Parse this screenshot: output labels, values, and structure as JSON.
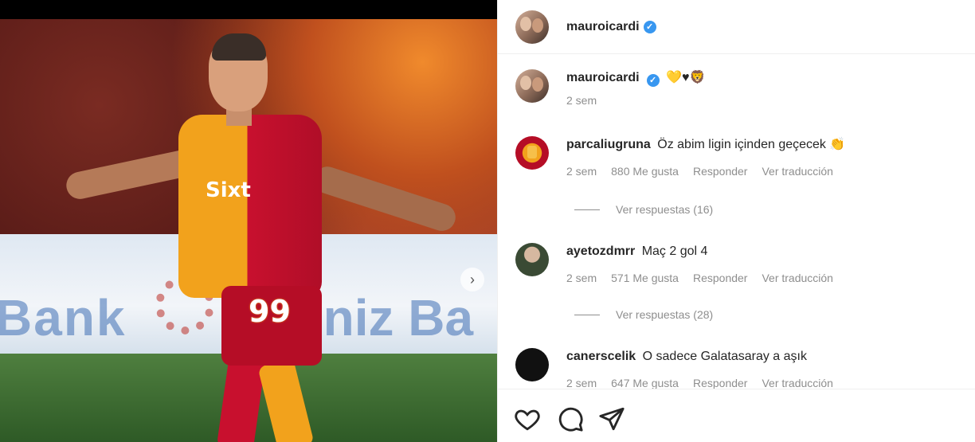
{
  "post": {
    "username": "mauroicardi",
    "verified": true,
    "caption": "💛♥🦁",
    "time": "2 sem",
    "jersey_sponsor": "Sixt",
    "jersey_number": "99",
    "board_text_left": "Bank",
    "board_text_right": "eniz Ba",
    "next_glyph": "›"
  },
  "comments": [
    {
      "username": "parcaliugruna",
      "text": "Öz abim ligin içinden geçecek 👏",
      "time": "2 sem",
      "likes": "880 Me gusta",
      "reply": "Responder",
      "translate": "Ver traducción",
      "replies_label": "Ver respuestas (16)"
    },
    {
      "username": "ayetozdmrr",
      "text": "Maç 2 gol 4",
      "time": "2 sem",
      "likes": "571 Me gusta",
      "reply": "Responder",
      "translate": "Ver traducción",
      "replies_label": "Ver respuestas (28)"
    },
    {
      "username": "canerscelik",
      "text": "O sadece Galatasaray a aşık",
      "time": "2 sem",
      "likes": "647 Me gusta",
      "reply": "Responder",
      "translate": "Ver traducción"
    }
  ],
  "icons": {
    "like": "heart-icon",
    "comment": "comment-icon",
    "share": "paper-plane-icon",
    "verified": "verified-badge-icon"
  },
  "colors": {
    "verified": "#3897f0",
    "muted_text": "#8e8e8e",
    "galatasaray_red": "#b50d26",
    "galatasaray_yellow": "#f2a21c"
  }
}
